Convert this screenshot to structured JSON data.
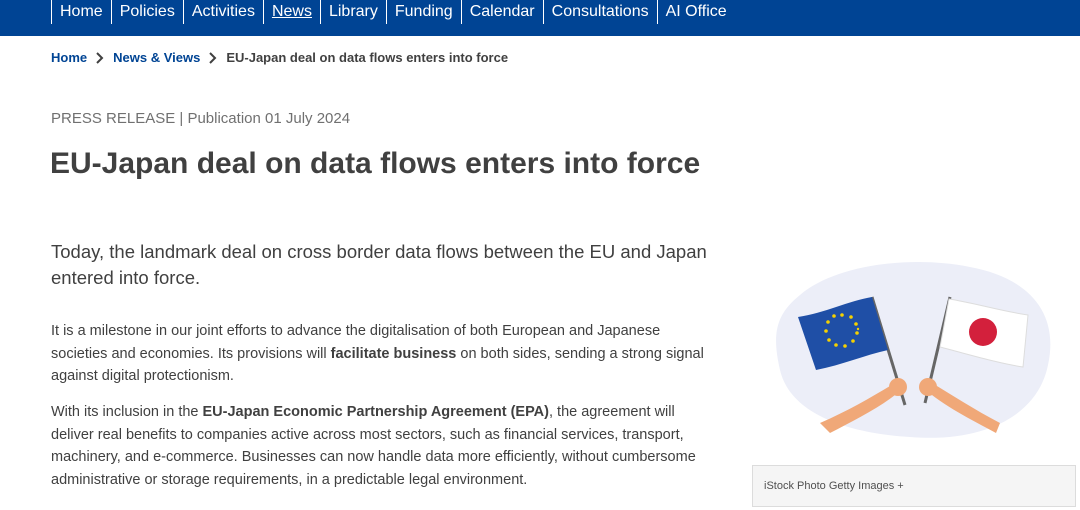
{
  "nav": {
    "items": [
      {
        "label": "Home",
        "active": false
      },
      {
        "label": "Policies",
        "active": false
      },
      {
        "label": "Activities",
        "active": false
      },
      {
        "label": "News",
        "active": true
      },
      {
        "label": "Library",
        "active": false
      },
      {
        "label": "Funding",
        "active": false
      },
      {
        "label": "Calendar",
        "active": false
      },
      {
        "label": "Consultations",
        "active": false
      },
      {
        "label": "AI Office",
        "active": false
      }
    ],
    "background_color": "#004494"
  },
  "breadcrumb": {
    "home": "Home",
    "section": "News & Views",
    "current": "EU-Japan deal on data flows enters into force",
    "separator_icon": "chevron-right-icon"
  },
  "article": {
    "meta": "PRESS RELEASE | Publication 01 July 2024",
    "title": "EU-Japan deal on data flows enters into force",
    "lead": "Today, the landmark deal on cross border data flows between the EU and Japan entered into force.",
    "p1": {
      "before": "It is a milestone in our joint efforts to advance the digitalisation of both European and Japanese societies and economies. Its provisions will ",
      "bold": "facilitate business",
      "after": " on both sides, sending a strong signal against digital protectionism."
    },
    "p2": {
      "before": "With its inclusion in the ",
      "bold": "EU-Japan Economic Partnership Agreement (EPA)",
      "after": ", the agreement will deliver real benefits to companies active across most sectors, such as financial services, transport, machinery, and e-commerce. Businesses can now handle data more efficiently, without cumbersome administrative or storage requirements, in a predictable legal environment."
    }
  },
  "figure": {
    "caption": "iStock Photo Getty Images +",
    "icons": [
      "eu-flag-icon",
      "japan-flag-icon",
      "hands-icon"
    ],
    "colors": {
      "eu_blue": "#1f4fa6",
      "eu_stars": "#f5d100",
      "japan_red": "#d3203c",
      "blob": "#eceef8"
    }
  }
}
